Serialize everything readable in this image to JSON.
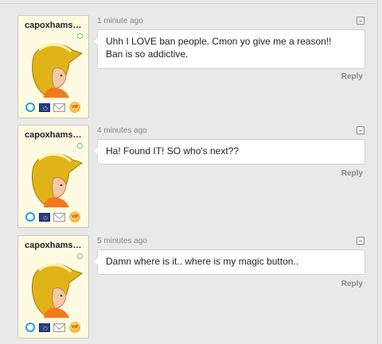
{
  "colors": {
    "background": "#e9e9e9",
    "card": "#fffbe3",
    "online": "#6bbd4a",
    "male": "#1fa0e6"
  },
  "comments": [
    {
      "username": "capoxhams…",
      "timestamp": "1 minute ago",
      "body_lines": [
        "Uhh I LOVE ban people. Cmon yo give me a reason!!",
        "Ban is so addictive."
      ],
      "reply_label": "Reply",
      "badges": [
        "male-icon",
        "eu-flag-icon",
        "mail-icon",
        "vip-icon"
      ],
      "vip_text": "VIP"
    },
    {
      "username": "capoxhams…",
      "timestamp": "4 minutes ago",
      "body_lines": [
        "Ha! Found IT! SO who's next??"
      ],
      "reply_label": "Reply",
      "badges": [
        "male-icon",
        "eu-flag-icon",
        "mail-icon",
        "vip-icon"
      ],
      "vip_text": "VIP"
    },
    {
      "username": "capoxhams…",
      "timestamp": "5 minutes ago",
      "body_lines": [
        "Damn where is it.. where is my magic button.."
      ],
      "reply_label": "Reply",
      "badges": [
        "male-icon",
        "eu-flag-icon",
        "mail-icon",
        "vip-icon"
      ],
      "vip_text": "VIP"
    }
  ]
}
